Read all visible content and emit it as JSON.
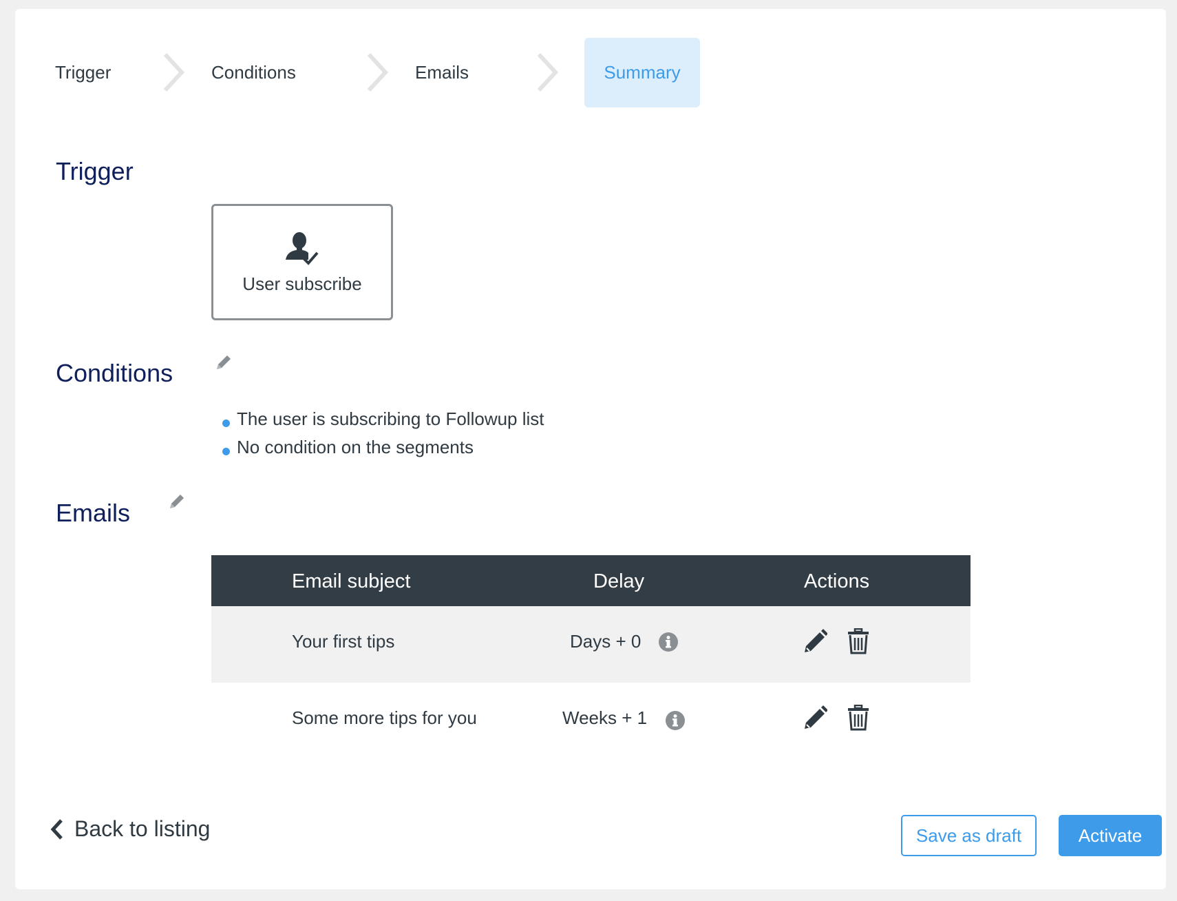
{
  "stepper": {
    "steps": [
      {
        "label": "Trigger"
      },
      {
        "label": "Conditions"
      },
      {
        "label": "Emails"
      },
      {
        "label": "Summary"
      }
    ],
    "active_step": "Summary"
  },
  "trigger": {
    "title": "Trigger",
    "card_label": "User subscribe",
    "card_icon": "user-check-icon"
  },
  "conditions": {
    "title": "Conditions",
    "items": [
      "The user is subscribing to Followup list",
      "No condition on the segments"
    ]
  },
  "emails": {
    "title": "Emails",
    "table": {
      "headers": {
        "subject": "Email subject",
        "delay": "Delay",
        "actions": "Actions"
      },
      "rows": [
        {
          "subject": "Your first tips",
          "delay": "Days + 0"
        },
        {
          "subject": "Some more tips for you",
          "delay": "Weeks + 1"
        }
      ]
    }
  },
  "footer": {
    "back_label": "Back to listing",
    "draft_label": "Save as draft",
    "activate_label": "Activate"
  },
  "colors": {
    "accent": "#3d9be9",
    "heading": "#0f1f5a",
    "table_header_bg": "#333d45",
    "active_step_bg": "#dceefb"
  }
}
